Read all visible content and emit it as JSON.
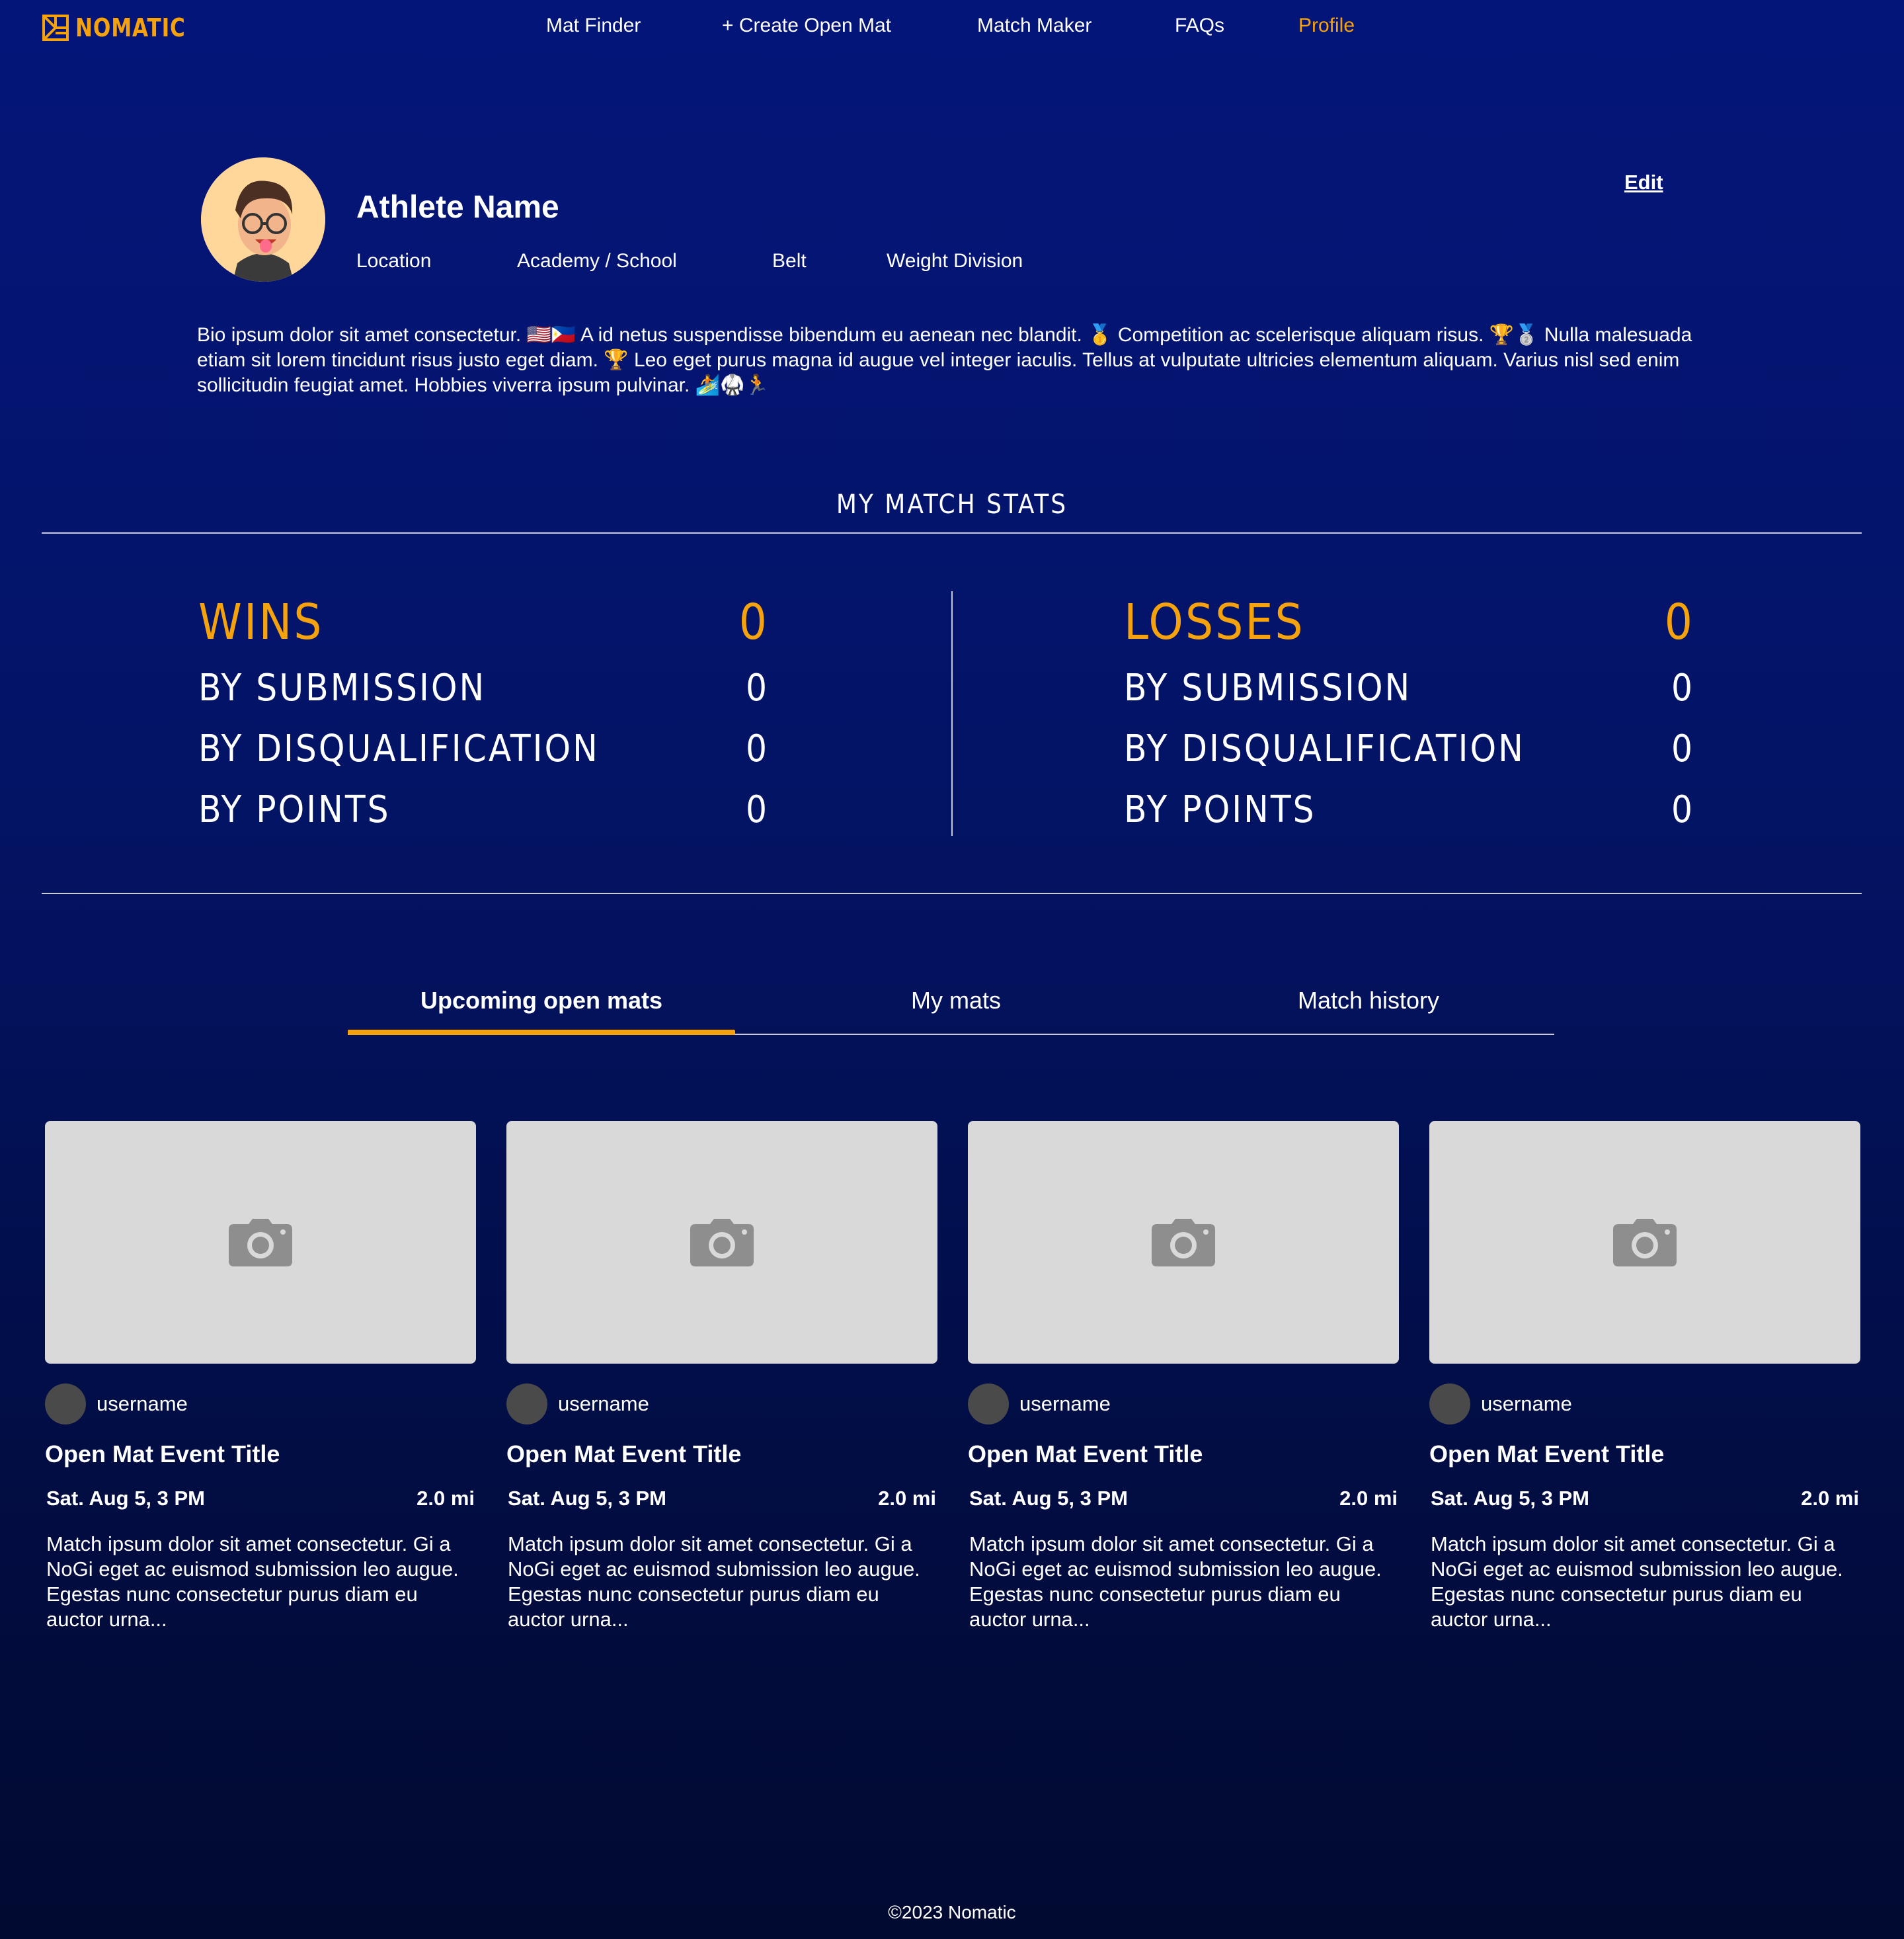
{
  "brand": {
    "name": "NOMATIC",
    "accent_color": "#f5a20c",
    "bg_color": "#04157a"
  },
  "nav": {
    "links": [
      {
        "label": "Mat Finder"
      },
      {
        "label": "+ Create Open Mat"
      },
      {
        "label": "Match Maker"
      },
      {
        "label": "FAQs"
      },
      {
        "label": "Profile",
        "active": true
      }
    ]
  },
  "profile": {
    "name": "Athlete Name",
    "location": "Location",
    "academy": "Academy / School",
    "belt": "Belt",
    "weight_division": "Weight Division",
    "edit_label": "Edit",
    "bio": "Bio ipsum dolor sit amet consectetur. 🇺🇸🇵🇭 A id netus suspendisse bibendum eu aenean nec blandit. 🥇 Competition ac scelerisque aliquam risus. 🏆🥈 Nulla malesuada etiam sit lorem tincidunt risus justo eget diam. 🏆 Leo eget purus magna id augue vel integer iaculis. Tellus at vulputate ultricies elementum aliquam. Varius nisl sed enim sollicitudin feugiat amet. Hobbies viverra ipsum pulvinar. 🏄🥋🏃"
  },
  "stats": {
    "title": "MY MATCH STATS",
    "wins": {
      "label": "WINS",
      "value": "0",
      "rows": [
        {
          "label": "BY SUBMISSION",
          "value": "0"
        },
        {
          "label": "BY DISQUALIFICATION",
          "value": "0"
        },
        {
          "label": "BY POINTS",
          "value": "0"
        }
      ]
    },
    "losses": {
      "label": "LOSSES",
      "value": "0",
      "rows": [
        {
          "label": "BY SUBMISSION",
          "value": "0"
        },
        {
          "label": "BY DISQUALIFICATION",
          "value": "0"
        },
        {
          "label": "BY POINTS",
          "value": "0"
        }
      ]
    }
  },
  "tabs": [
    {
      "label": "Upcoming open mats",
      "active": true
    },
    {
      "label": "My mats"
    },
    {
      "label": "Match history"
    }
  ],
  "cards": [
    {
      "username": "username",
      "title": "Open Mat Event Title",
      "date": "Sat. Aug 5, 3 PM",
      "distance": "2.0 mi",
      "description": "Match ipsum dolor sit amet consectetur. Gi a NoGi eget ac euismod submission leo augue. Egestas nunc consectetur purus diam eu auctor urna..."
    },
    {
      "username": "username",
      "title": "Open Mat Event Title",
      "date": "Sat. Aug 5, 3 PM",
      "distance": "2.0 mi",
      "description": "Match ipsum dolor sit amet consectetur. Gi a NoGi eget ac euismod submission leo augue. Egestas nunc consectetur purus diam eu auctor urna..."
    },
    {
      "username": "username",
      "title": "Open Mat Event Title",
      "date": "Sat. Aug 5, 3 PM",
      "distance": "2.0 mi",
      "description": "Match ipsum dolor sit amet consectetur. Gi a NoGi eget ac euismod submission leo augue. Egestas nunc consectetur purus diam eu auctor urna..."
    },
    {
      "username": "username",
      "title": "Open Mat Event Title",
      "date": "Sat. Aug 5, 3 PM",
      "distance": "2.0 mi",
      "description": "Match ipsum dolor sit amet consectetur. Gi a NoGi eget ac euismod submission leo augue. Egestas nunc consectetur purus diam eu auctor urna..."
    }
  ],
  "footer": {
    "text": "©2023 Nomatic"
  }
}
